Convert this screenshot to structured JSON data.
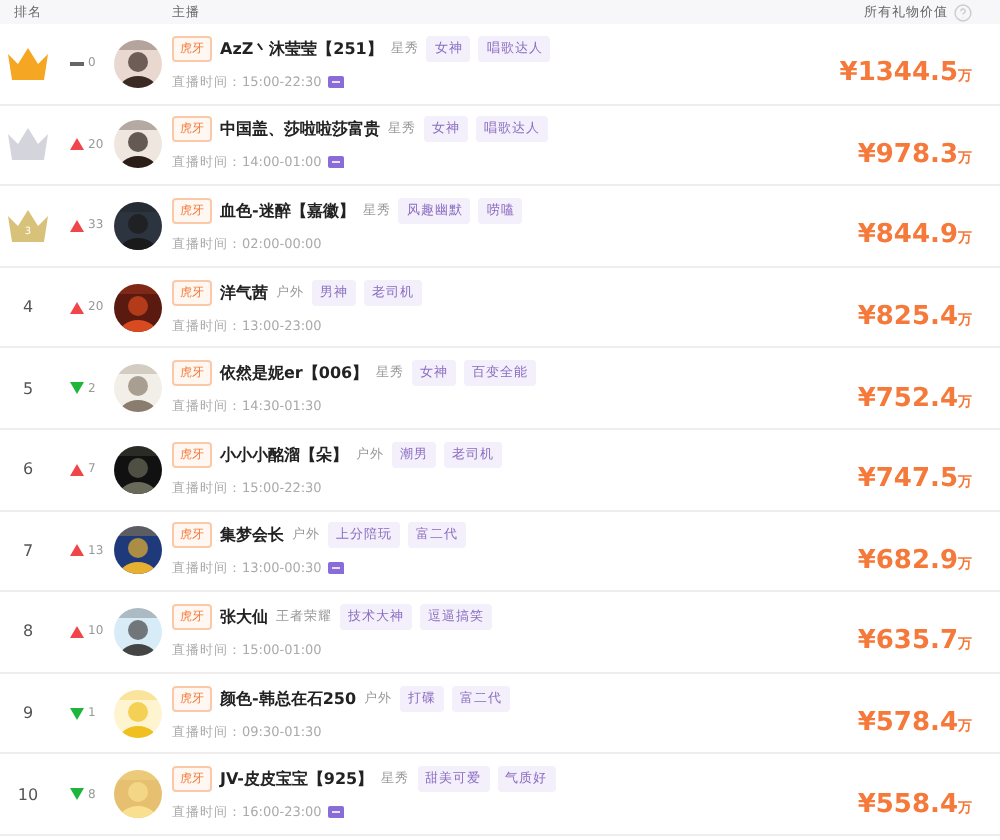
{
  "header": {
    "rank": "排名",
    "streamer": "主播",
    "gift_value": "所有礼物价值"
  },
  "rows": [
    {
      "crown": {
        "color": "#f5a623"
      },
      "rank_change": {
        "kind": "same",
        "value": "0"
      },
      "platform": "虎牙",
      "name": "AzZ丶沐莹莹【251】",
      "category": "星秀",
      "tags": [
        "女神",
        "唱歌达人"
      ],
      "time": "直播时间：15:00-22:30",
      "chat": true,
      "value": "¥1344.5",
      "unit": "万"
    },
    {
      "crown": {
        "color": "#d4d4dc"
      },
      "rank_change": {
        "kind": "up",
        "value": "20"
      },
      "platform": "虎牙",
      "name": "中国盖、莎啦啦莎富贵",
      "category": "星秀",
      "tags": [
        "女神",
        "唱歌达人"
      ],
      "time": "直播时间：14:00-01:00",
      "chat": true,
      "value": "¥978.3",
      "unit": "万"
    },
    {
      "crown": {
        "color": "#d8c27a"
      },
      "rank": "3",
      "rank_change": {
        "kind": "up",
        "value": "33"
      },
      "platform": "虎牙",
      "name": "血色-迷醉【嘉徽】",
      "category": "星秀",
      "tags": [
        "风趣幽默",
        "唠嗑"
      ],
      "time": "直播时间：02:00-00:00",
      "chat": false,
      "value": "¥844.9",
      "unit": "万"
    },
    {
      "rank": "4",
      "rank_change": {
        "kind": "up",
        "value": "20"
      },
      "platform": "虎牙",
      "name": "洋气茜",
      "category": "户外",
      "tags": [
        "男神",
        "老司机"
      ],
      "time": "直播时间：13:00-23:00",
      "chat": false,
      "value": "¥825.4",
      "unit": "万"
    },
    {
      "rank": "5",
      "rank_change": {
        "kind": "down",
        "value": "2"
      },
      "platform": "虎牙",
      "name": "依然是妮er【006】",
      "category": "星秀",
      "tags": [
        "女神",
        "百变全能"
      ],
      "time": "直播时间：14:30-01:30",
      "chat": false,
      "value": "¥752.4",
      "unit": "万"
    },
    {
      "rank": "6",
      "rank_change": {
        "kind": "up",
        "value": "7"
      },
      "platform": "虎牙",
      "name": "小小小酩溜【朵】",
      "category": "户外",
      "tags": [
        "潮男",
        "老司机"
      ],
      "time": "直播时间：15:00-22:30",
      "chat": false,
      "value": "¥747.5",
      "unit": "万"
    },
    {
      "rank": "7",
      "rank_change": {
        "kind": "up",
        "value": "13"
      },
      "platform": "虎牙",
      "name": "集梦会长",
      "category": "户外",
      "tags": [
        "上分陪玩",
        "富二代"
      ],
      "time": "直播时间：13:00-00:30",
      "chat": true,
      "value": "¥682.9",
      "unit": "万"
    },
    {
      "rank": "8",
      "rank_change": {
        "kind": "up",
        "value": "10"
      },
      "platform": "虎牙",
      "name": "张大仙",
      "category": "王者荣耀",
      "tags": [
        "技术大神",
        "逗逼搞笑"
      ],
      "time": "直播时间：15:00-01:00",
      "chat": false,
      "value": "¥635.7",
      "unit": "万"
    },
    {
      "rank": "9",
      "rank_change": {
        "kind": "down",
        "value": "1"
      },
      "platform": "虎牙",
      "name": "颜色-韩总在石250",
      "category": "户外",
      "tags": [
        "打碟",
        "富二代"
      ],
      "time": "直播时间：09:30-01:30",
      "chat": false,
      "value": "¥578.4",
      "unit": "万"
    },
    {
      "rank": "10",
      "rank_change": {
        "kind": "down",
        "value": "8"
      },
      "platform": "虎牙",
      "name": "JV-皮皮宝宝【925】",
      "category": "星秀",
      "tags": [
        "甜美可爱",
        "气质好"
      ],
      "time": "直播时间：16:00-23:00",
      "chat": true,
      "value": "¥558.4",
      "unit": "万"
    }
  ]
}
